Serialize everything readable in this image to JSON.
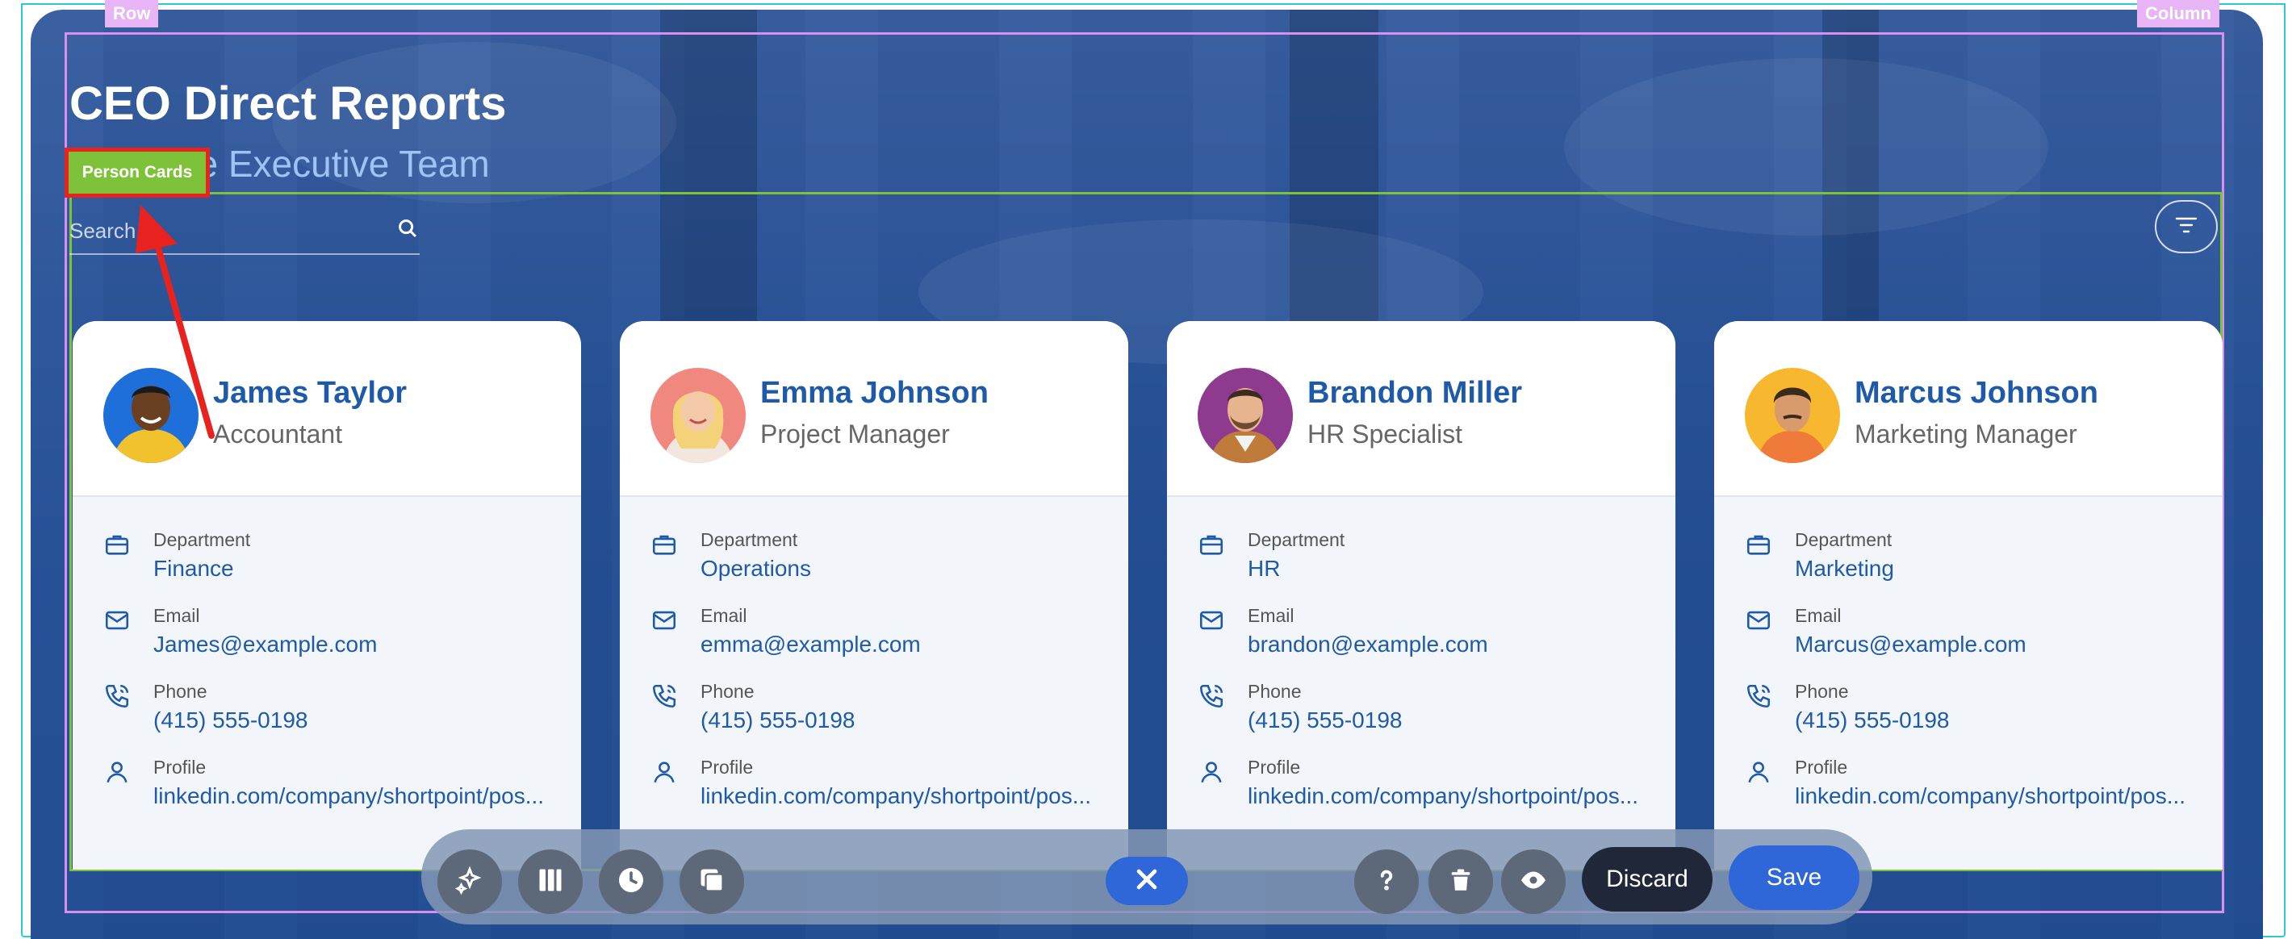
{
  "builder": {
    "row_tag": "Row",
    "column_tag": "Column",
    "person_cards_tag": "Person Cards"
  },
  "header": {
    "title": "CEO Direct Reports",
    "subtitle": "t with the Executive Team"
  },
  "search": {
    "placeholder": "Search"
  },
  "cards": [
    {
      "name": "James Taylor",
      "role": "Accountant",
      "fields": [
        {
          "label": "Department",
          "value": "Finance",
          "icon": "briefcase-icon"
        },
        {
          "label": "Email",
          "value": "James@example.com",
          "icon": "mail-icon"
        },
        {
          "label": "Phone",
          "value": "(415) 555-0198",
          "icon": "phone-icon"
        },
        {
          "label": "Profile",
          "value": "linkedin.com/company/shortpoint/pos...",
          "icon": "user-icon"
        }
      ]
    },
    {
      "name": "Emma Johnson",
      "role": "Project Manager",
      "fields": [
        {
          "label": "Department",
          "value": "Operations",
          "icon": "briefcase-icon"
        },
        {
          "label": "Email",
          "value": "emma@example.com",
          "icon": "mail-icon"
        },
        {
          "label": "Phone",
          "value": "(415) 555-0198",
          "icon": "phone-icon"
        },
        {
          "label": "Profile",
          "value": "linkedin.com/company/shortpoint/pos...",
          "icon": "user-icon"
        }
      ]
    },
    {
      "name": "Brandon Miller",
      "role": "HR Specialist",
      "fields": [
        {
          "label": "Department",
          "value": "HR",
          "icon": "briefcase-icon"
        },
        {
          "label": "Email",
          "value": "brandon@example.com",
          "icon": "mail-icon"
        },
        {
          "label": "Phone",
          "value": "(415) 555-0198",
          "icon": "phone-icon"
        },
        {
          "label": "Profile",
          "value": "linkedin.com/company/shortpoint/pos...",
          "icon": "user-icon"
        }
      ]
    },
    {
      "name": "Marcus Johnson",
      "role": "Marketing Manager",
      "fields": [
        {
          "label": "Department",
          "value": "Marketing",
          "icon": "briefcase-icon"
        },
        {
          "label": "Email",
          "value": "Marcus@example.com",
          "icon": "mail-icon"
        },
        {
          "label": "Phone",
          "value": "(415) 555-0198",
          "icon": "phone-icon"
        },
        {
          "label": "Profile",
          "value": "linkedin.com/company/shortpoint/pos...",
          "icon": "user-icon"
        }
      ]
    }
  ],
  "toolbar": {
    "discard_label": "Discard",
    "save_label": "Save",
    "left_icons": [
      "sparkle-icon",
      "columns-icon",
      "clock-icon",
      "copy-icon"
    ],
    "right_icons": [
      "help-icon",
      "trash-icon",
      "eye-icon"
    ]
  },
  "colors": {
    "accent_blue": "#2f66d8",
    "name_blue": "#1f5aa8",
    "row_frame": "#d88ff0",
    "cards_frame": "#7ec23a",
    "highlight_red": "#e8231f"
  }
}
